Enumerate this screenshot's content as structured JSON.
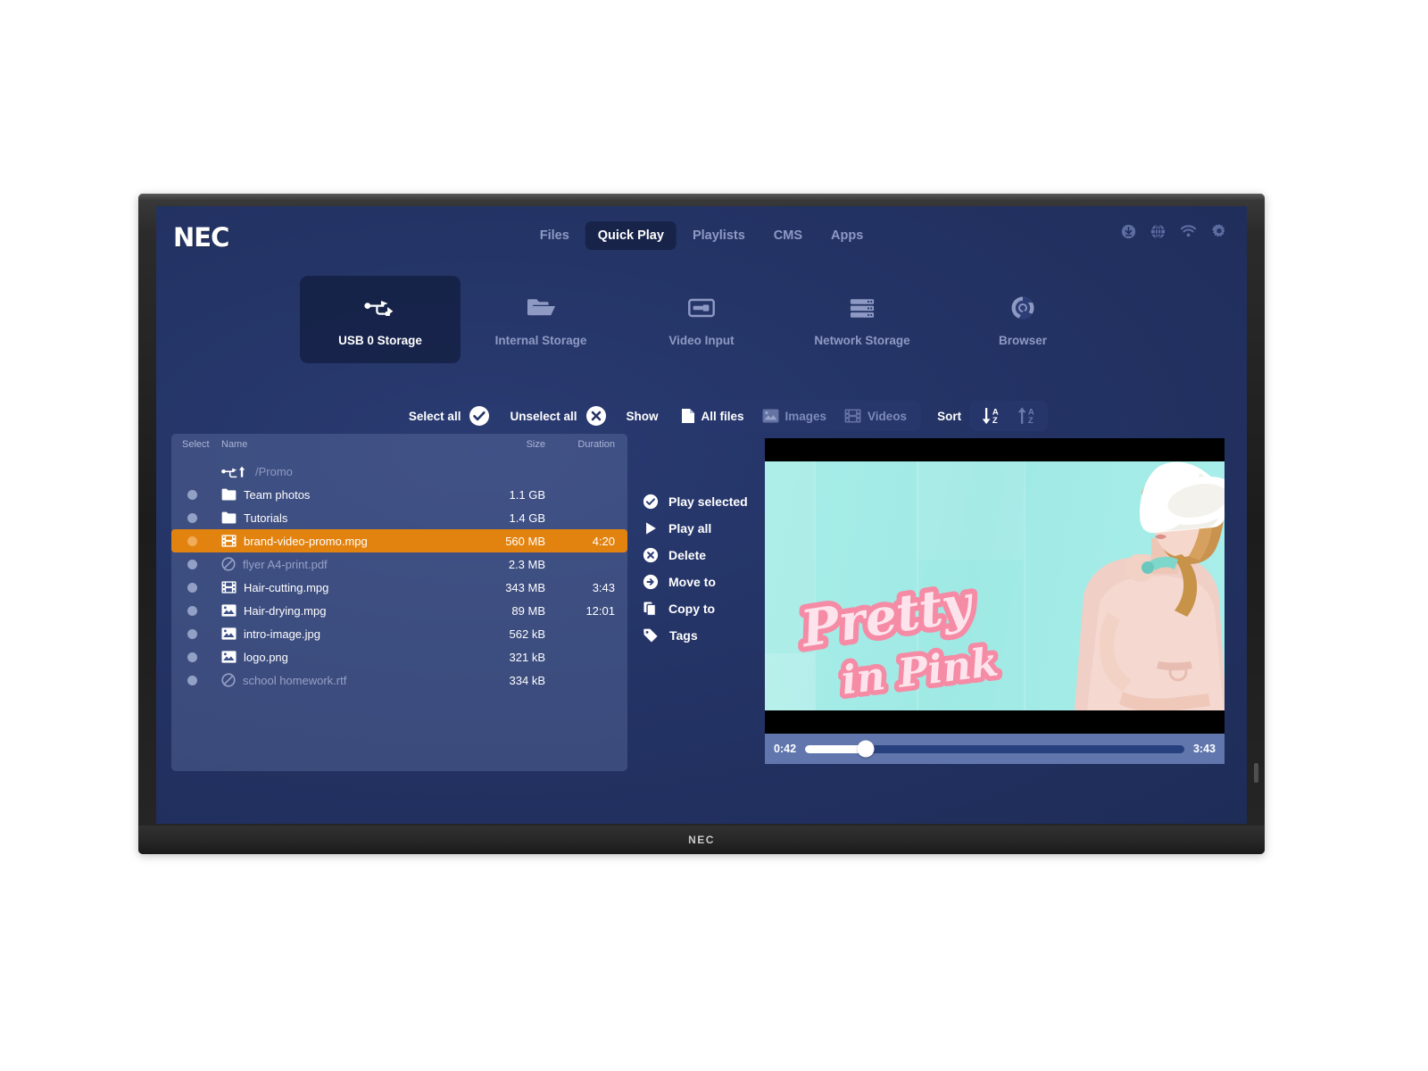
{
  "brand": {
    "logo": "NEC",
    "bezel_logo": "NEC"
  },
  "nav": {
    "items": [
      {
        "label": "Files",
        "active": false
      },
      {
        "label": "Quick Play",
        "active": true
      },
      {
        "label": "Playlists",
        "active": false
      },
      {
        "label": "CMS",
        "active": false
      },
      {
        "label": "Apps",
        "active": false
      }
    ]
  },
  "system_icons": [
    {
      "name": "download-icon"
    },
    {
      "name": "globe-icon"
    },
    {
      "name": "wifi-icon"
    },
    {
      "name": "gear-icon"
    }
  ],
  "storage_tabs": [
    {
      "label": "USB 0 Storage",
      "icon": "usb-icon",
      "active": true
    },
    {
      "label": "Internal Storage",
      "icon": "folder-icon",
      "active": false
    },
    {
      "label": "Video Input",
      "icon": "video-input-icon",
      "active": false
    },
    {
      "label": "Network Storage",
      "icon": "server-icon",
      "active": false
    },
    {
      "label": "Browser",
      "icon": "chrome-icon",
      "active": false
    }
  ],
  "toolbar": {
    "select_all_label": "Select all",
    "unselect_all_label": "Unselect all",
    "show_label": "Show",
    "filters": [
      {
        "label": "All files",
        "icon": "document-icon",
        "active": true
      },
      {
        "label": "Images",
        "icon": "image-icon",
        "active": false
      },
      {
        "label": "Videos",
        "icon": "film-icon",
        "active": false
      }
    ],
    "sort_label": "Sort",
    "sort_options": [
      {
        "name": "sort-descending-az",
        "active": true
      },
      {
        "name": "sort-ascending-az",
        "active": false
      }
    ]
  },
  "filelist": {
    "columns": {
      "select": "Select",
      "name": "Name",
      "size": "Size",
      "duration": "Duration"
    },
    "parent": {
      "path": "/Promo",
      "icon": "usb-up-icon"
    },
    "rows": [
      {
        "name": "Team photos",
        "size": "1.1 GB",
        "duration": "",
        "icon": "folder-icon",
        "state": "normal",
        "selected": false
      },
      {
        "name": "Tutorials",
        "size": "1.4 GB",
        "duration": "",
        "icon": "folder-icon",
        "state": "normal",
        "selected": false
      },
      {
        "name": "brand-video-promo.mpg",
        "size": "560 MB",
        "duration": "4:20",
        "icon": "film-icon",
        "state": "normal",
        "selected": true
      },
      {
        "name": "flyer A4-print.pdf",
        "size": "2.3 MB",
        "duration": "",
        "icon": "blocked-icon",
        "state": "disabled",
        "selected": false
      },
      {
        "name": "Hair-cutting.mpg",
        "size": "343 MB",
        "duration": "3:43",
        "icon": "film-icon",
        "state": "normal",
        "selected": false
      },
      {
        "name": "Hair-drying.mpg",
        "size": "89 MB",
        "duration": "12:01",
        "icon": "image-icon",
        "state": "normal",
        "selected": false
      },
      {
        "name": "intro-image.jpg",
        "size": "562 kB",
        "duration": "",
        "icon": "image-icon",
        "state": "normal",
        "selected": false
      },
      {
        "name": "logo.png",
        "size": "321 kB",
        "duration": "",
        "icon": "image-icon",
        "state": "normal",
        "selected": false
      },
      {
        "name": "school homework.rtf",
        "size": "334 kB",
        "duration": "",
        "icon": "blocked-icon",
        "state": "disabled",
        "selected": false
      }
    ]
  },
  "actions": [
    {
      "label": "Play selected",
      "icon": "check-circle-icon"
    },
    {
      "label": "Play all",
      "icon": "play-icon"
    },
    {
      "label": "Delete",
      "icon": "x-circle-icon"
    },
    {
      "label": "Move to",
      "icon": "arrow-circle-icon"
    },
    {
      "label": "Copy to",
      "icon": "copy-icon"
    },
    {
      "label": "Tags",
      "icon": "tag-icon"
    }
  ],
  "player": {
    "current_time": "0:42",
    "total_time": "3:43",
    "progress_percent": 16,
    "video_title_line1": "Pretty",
    "video_title_line2": "in Pink"
  },
  "colors": {
    "accent_orange": "#e3830f",
    "screen_bg": "#243466",
    "nav_active_bg": "#18234a",
    "panel_bg": "rgba(108,127,175,0.34)",
    "player_bar": "#6076ad",
    "track_bg": "#27407e"
  }
}
